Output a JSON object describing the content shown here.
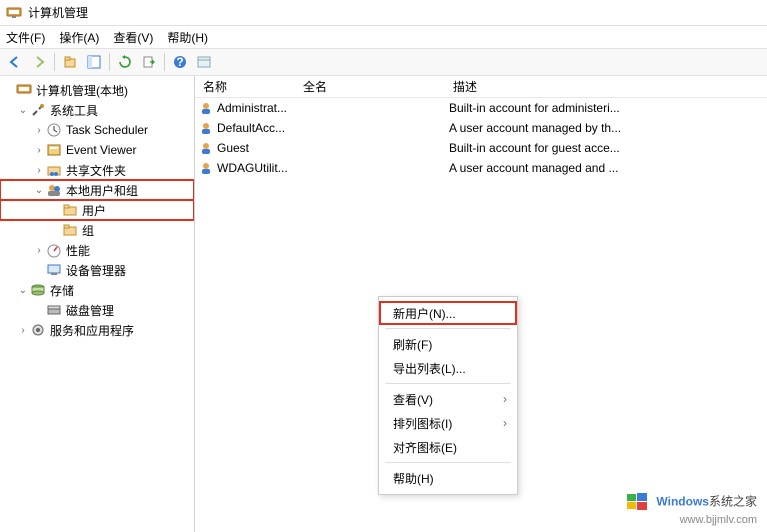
{
  "title": "计算机管理",
  "menu": {
    "file": "文件(F)",
    "action": "操作(A)",
    "view": "查看(V)",
    "help": "帮助(H)"
  },
  "tree": {
    "root": "计算机管理(本地)",
    "sys_tools": "系统工具",
    "task_scheduler": "Task Scheduler",
    "event_viewer": "Event Viewer",
    "shared_folders": "共享文件夹",
    "local_users": "本地用户和组",
    "users": "用户",
    "groups": "组",
    "performance": "性能",
    "device_manager": "设备管理器",
    "storage": "存储",
    "disk_mgmt": "磁盘管理",
    "services_apps": "服务和应用程序"
  },
  "columns": {
    "name": "名称",
    "fullname": "全名",
    "desc": "描述"
  },
  "rows": [
    {
      "name": "Administrat...",
      "desc": "Built-in account for administeri..."
    },
    {
      "name": "DefaultAcc...",
      "desc": "A user account managed by th..."
    },
    {
      "name": "Guest",
      "desc": "Built-in account for guest acce..."
    },
    {
      "name": "WDAGUtilit...",
      "desc": "A user account managed and ..."
    }
  ],
  "ctx": {
    "new_user": "新用户(N)...",
    "refresh": "刷新(F)",
    "export": "导出列表(L)...",
    "view": "查看(V)",
    "arrange": "排列图标(I)",
    "align": "对齐图标(E)",
    "help": "帮助(H)"
  },
  "watermark": {
    "brand": "Windows",
    "zh": "系统之家",
    "url": "www.bjjmlv.com"
  }
}
